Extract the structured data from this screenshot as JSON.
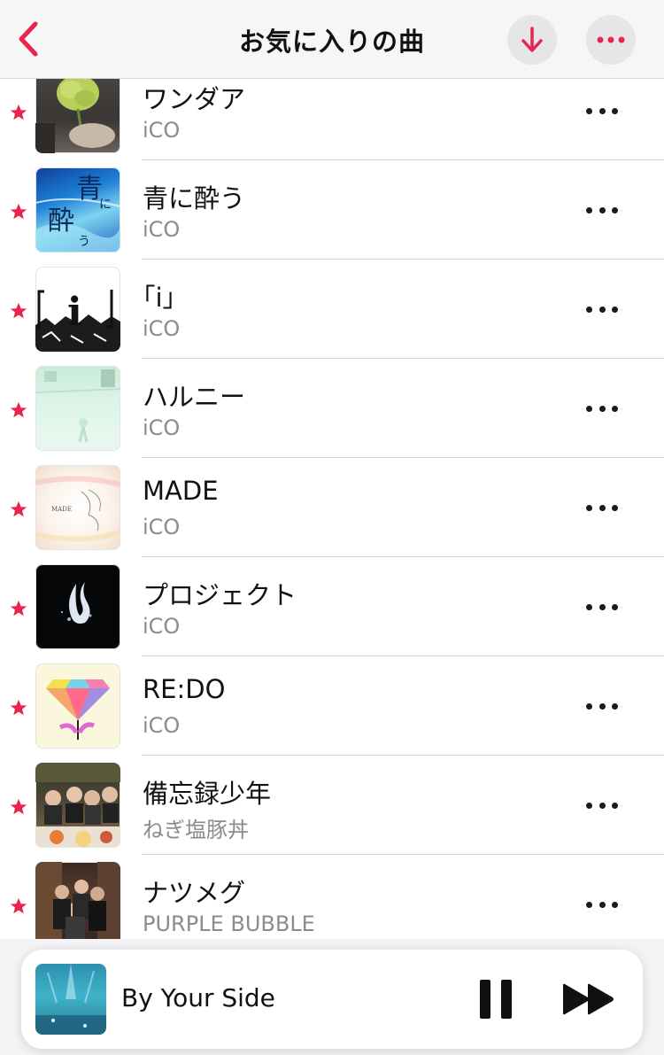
{
  "header": {
    "title": "お気に入りの曲",
    "accent_color": "#e8254f"
  },
  "songs": [
    {
      "title": "ワンダア",
      "artist": "iCO",
      "art": "flower"
    },
    {
      "title": "青に酔う",
      "artist": "iCO",
      "art": "blue-water",
      "art_text": "青に酔う"
    },
    {
      "title": "｢i｣",
      "artist": "iCO",
      "art": "i-bracket",
      "art_text": "｢i｣"
    },
    {
      "title": "ハルニー",
      "artist": "iCO",
      "art": "mint-sketch"
    },
    {
      "title": "MADE",
      "artist": "iCO",
      "art": "made-sketch",
      "art_text": "MADE"
    },
    {
      "title": "プロジェクト",
      "artist": "iCO",
      "art": "dark-flame"
    },
    {
      "title": "RE:DO",
      "artist": "iCO",
      "art": "diamond"
    },
    {
      "title": "備忘録少年",
      "artist": "ねぎ塩豚丼",
      "art": "band-photo"
    },
    {
      "title": "ナツメグ",
      "artist": "PURPLE BUBBLE",
      "art": "group-photo"
    }
  ],
  "now_playing": {
    "title": "By Your Side",
    "art": "underwater"
  },
  "icons": {
    "back": "chevron-left-icon",
    "download": "arrow-down-icon",
    "more": "ellipsis-icon",
    "favorite": "star-icon",
    "pause": "pause-icon",
    "forward": "fast-forward-icon"
  }
}
